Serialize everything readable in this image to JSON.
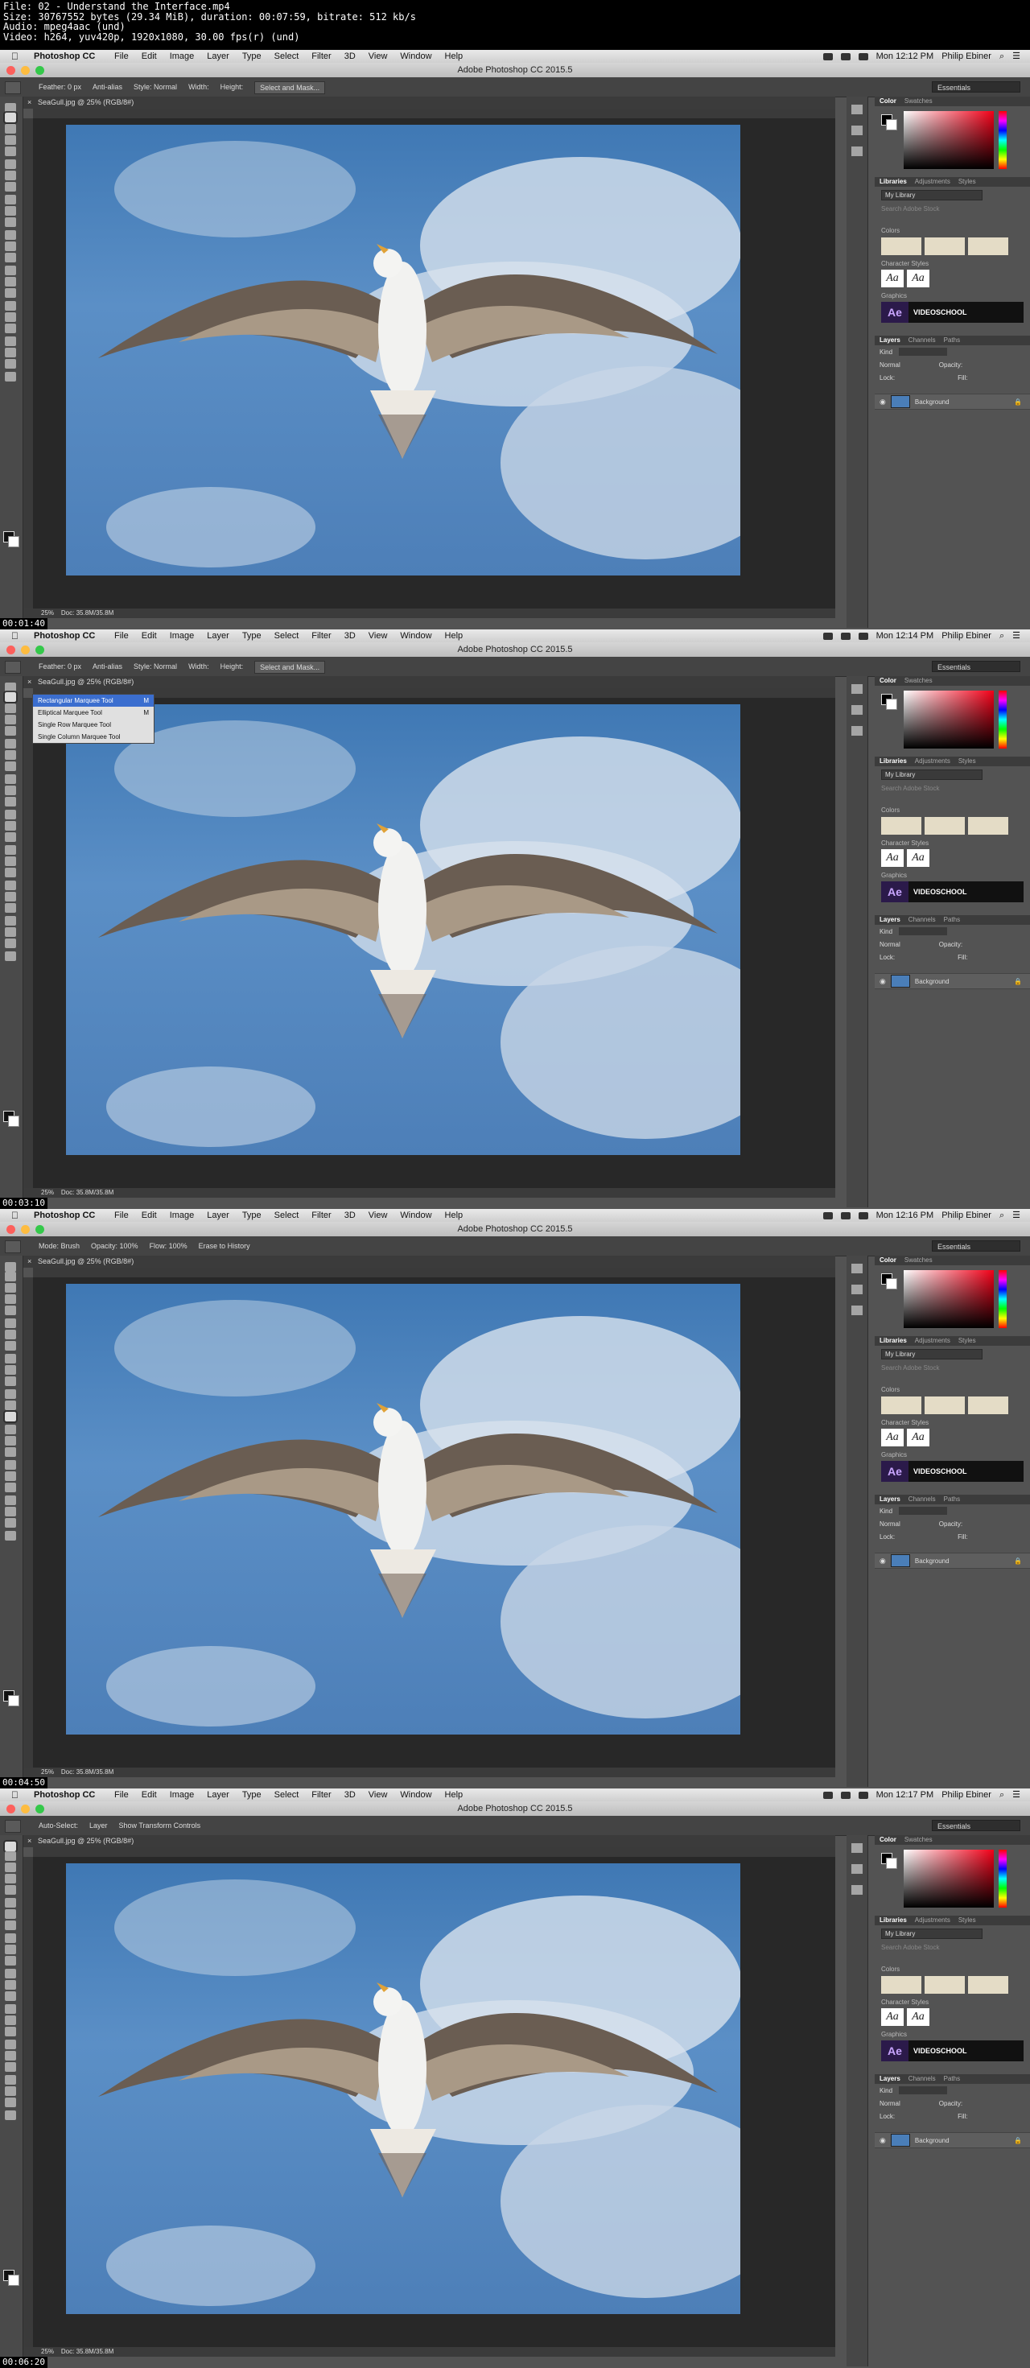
{
  "file_info": {
    "lines": [
      "File: 02 - Understand the Interface.mp4",
      "Size: 30767552 bytes (29.34 MiB), duration: 00:07:59, bitrate: 512 kb/s",
      "Audio: mpeg4aac (und)",
      "Video: h264, yuv420p, 1920x1080, 30.00 fps(r) (und)"
    ]
  },
  "frames": [
    {
      "timestamp": "00:01:40",
      "clock": "Mon 12:12 PM",
      "tool": "marquee",
      "options": [
        "Feather: 0 px",
        "Anti-alias",
        "Style: Normal",
        "Width:",
        "Height:"
      ],
      "options_button": "Select and Mask...",
      "show_flyout": false
    },
    {
      "timestamp": "00:03:10",
      "clock": "Mon 12:14 PM",
      "tool": "marquee",
      "options": [
        "Feather: 0 px",
        "Anti-alias",
        "Style: Normal",
        "Width:",
        "Height:"
      ],
      "options_button": "Select and Mask...",
      "show_flyout": true
    },
    {
      "timestamp": "00:04:50",
      "clock": "Mon 12:16 PM",
      "tool": "history-brush",
      "options": [
        "Mode: Brush",
        "Opacity: 100%",
        "Flow: 100%",
        "Erase to History"
      ],
      "options_button": "",
      "show_flyout": false
    },
    {
      "timestamp": "00:06:20",
      "clock": "Mon 12:17 PM",
      "tool": "move",
      "options": [
        "Auto-Select:",
        "Layer",
        "Show Transform Controls"
      ],
      "options_button": "",
      "show_flyout": false
    }
  ],
  "menubar": {
    "app": "Photoshop CC",
    "menus": [
      "File",
      "Edit",
      "Image",
      "Layer",
      "Type",
      "Select",
      "Filter",
      "3D",
      "View",
      "Window",
      "Help"
    ],
    "user": "Philip Ebiner"
  },
  "window_title": "Adobe Photoshop CC 2015.5",
  "workspace": "Essentials",
  "document_tab": "SeaGull.jpg @ 25% (RGB/8#)",
  "status": "Doc: 35.8M/35.8M",
  "zoom": "25%",
  "panels": {
    "color_tabs": [
      "Color",
      "Swatches"
    ],
    "lib_tabs": [
      "Libraries",
      "Adjustments",
      "Styles"
    ],
    "library": "My Library",
    "search_placeholder": "Search Adobe Stock",
    "colors_label": "Colors",
    "character_styles_label": "Character Styles",
    "graphics_label": "Graphics",
    "char_style_text": "Aa",
    "graphic_text": "VIDEOSCHOOL",
    "ae_text": "Ae",
    "layer_tabs": [
      "Layers",
      "Channels",
      "Paths"
    ],
    "kind": "Kind",
    "blend": "Normal",
    "opacity": "Opacity:",
    "lock": "Lock:",
    "fill": "Fill:",
    "layer_name": "Background"
  },
  "flyout": {
    "items": [
      {
        "label": "Rectangular Marquee Tool",
        "key": "M",
        "selected": true
      },
      {
        "label": "Elliptical Marquee Tool",
        "key": "M",
        "selected": false
      },
      {
        "label": "Single Row Marquee Tool",
        "key": "",
        "selected": false
      },
      {
        "label": "Single Column Marquee Tool",
        "key": "",
        "selected": false
      }
    ]
  },
  "colors": {
    "sky": "#4a7eb8",
    "swatch": "#e4dcc6",
    "panel_bg": "#535353"
  }
}
